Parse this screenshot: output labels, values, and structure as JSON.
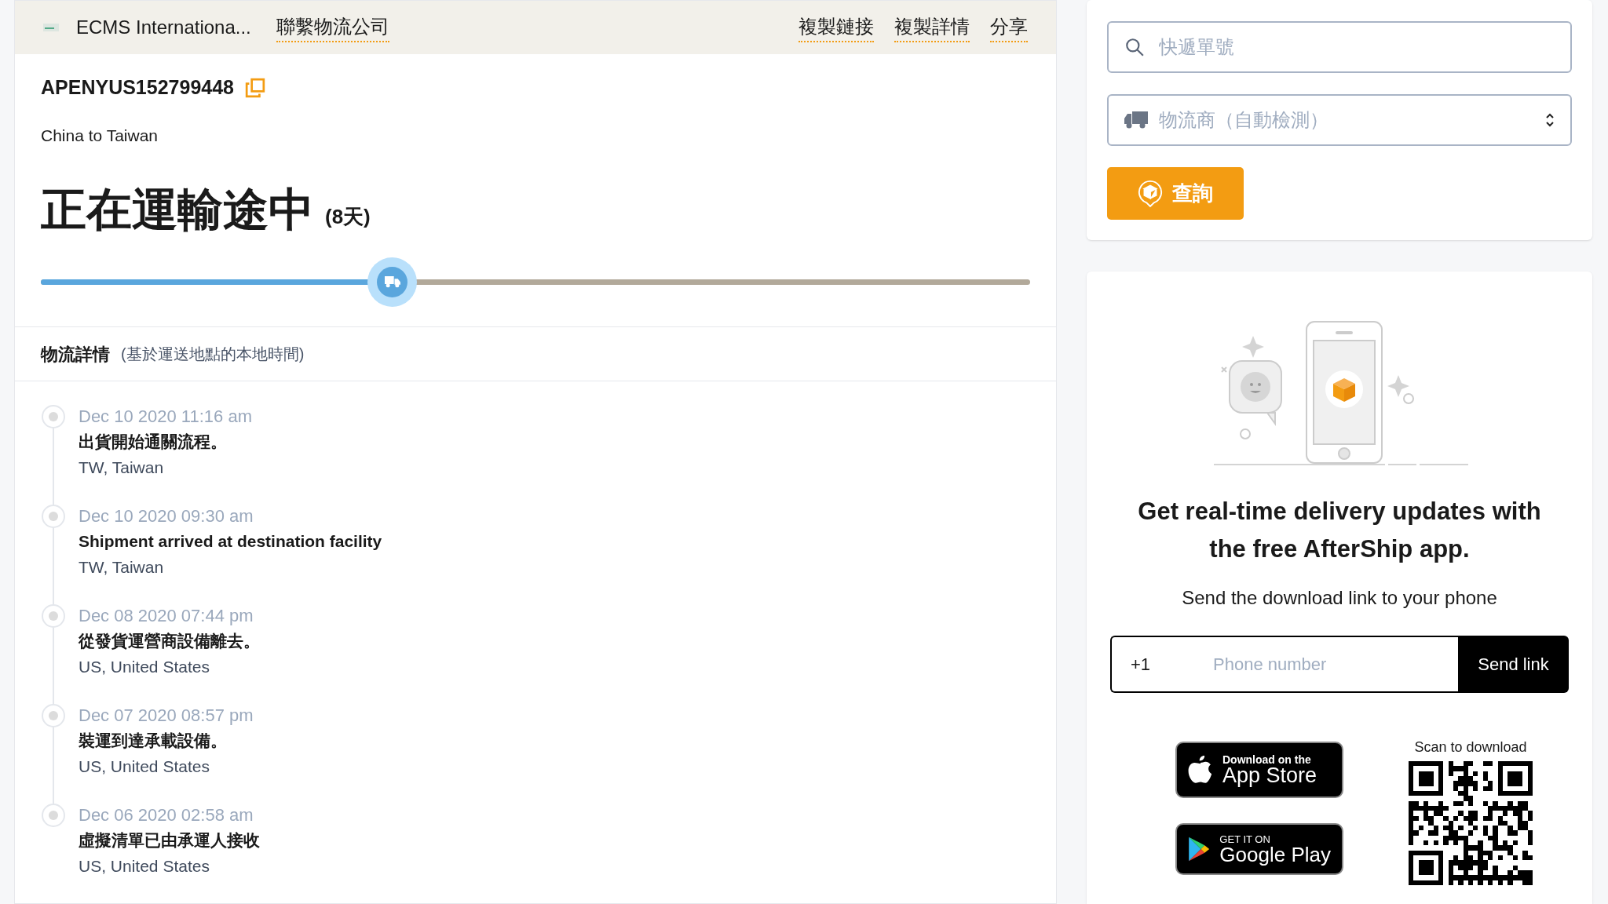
{
  "header": {
    "carrier": "ECMS Internationa...",
    "contact_link": "聯繫物流公司",
    "actions": [
      "複製鏈接",
      "複製詳情",
      "分享"
    ]
  },
  "tracking_number": "APENYUS152799448",
  "route": "China to Taiwan",
  "status": {
    "title": "正在運輸途中",
    "days": "(8天)"
  },
  "progress": {
    "level": 0.355
  },
  "details": {
    "title": "物流詳情",
    "note": "(基於運送地點的本地時間)"
  },
  "events": [
    {
      "date": "Dec 10 2020 11:16 am",
      "description": "出貨開始通關流程。",
      "location": "TW, Taiwan"
    },
    {
      "date": "Dec 10 2020 09:30 am",
      "description": "Shipment arrived at destination facility",
      "location": "TW, Taiwan"
    },
    {
      "date": "Dec 08 2020 07:44 pm",
      "description": "從發貨運營商設備離去。",
      "location": "US, United States"
    },
    {
      "date": "Dec 07 2020 08:57 pm",
      "description": "裝運到達承載設備。",
      "location": "US, United States"
    },
    {
      "date": "Dec 06 2020 02:58 am",
      "description": "虛擬清單已由承運人接收",
      "location": "US, United States"
    }
  ],
  "search": {
    "placeholder": "快遞單號"
  },
  "courier_select": {
    "placeholder": "物流商（自動檢測）"
  },
  "query_button": "查詢",
  "app_promo": {
    "heading": "Get real-time delivery updates with the free AfterShip app.",
    "subtext": "Send the download link to your phone",
    "phone": {
      "prefix": "+1",
      "placeholder": "Phone number"
    },
    "send_button": "Send link",
    "app_store": {
      "small": "Download on the",
      "big": "App Store"
    },
    "google_play": {
      "small": "GET IT ON",
      "big": "Google Play"
    },
    "qr_caption": "Scan to download"
  }
}
